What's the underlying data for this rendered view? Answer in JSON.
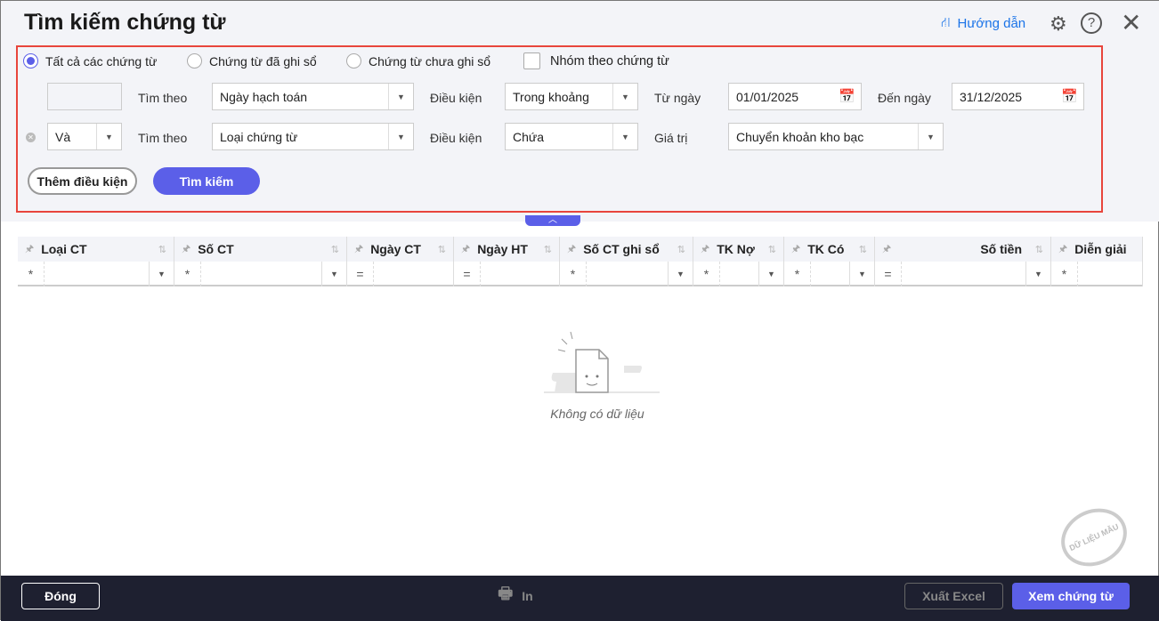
{
  "title": "Tìm kiếm chứng từ",
  "header": {
    "guide": "Hướng dẫn"
  },
  "filters": {
    "radios": [
      "Tất cả các chứng từ",
      "Chứng từ đã ghi sổ",
      "Chứng từ chưa ghi sổ"
    ],
    "selected_radio": 0,
    "group_checkbox": "Nhóm theo chứng từ",
    "row1": {
      "search_by_label": "Tìm theo",
      "search_by": "Ngày hạch toán",
      "cond_label": "Điều kiện",
      "cond": "Trong khoảng",
      "from_label": "Từ ngày",
      "from": "01/01/2025",
      "to_label": "Đến ngày",
      "to": "31/12/2025"
    },
    "row2": {
      "logic": "Và",
      "search_by_label": "Tìm theo",
      "search_by": "Loại chứng từ",
      "cond_label": "Điều kiện",
      "cond": "Chứa",
      "value_label": "Giá trị",
      "value": "Chuyển khoản kho bạc"
    },
    "add_condition": "Thêm điều kiện",
    "search": "Tìm kiếm"
  },
  "grid": {
    "columns": [
      "Loại CT",
      "Số CT",
      "Ngày CT",
      "Ngày HT",
      "Số CT ghi sổ",
      "TK Nợ",
      "TK Có",
      "Số tiền",
      "Diễn giải"
    ],
    "filter_ops": [
      "*",
      "*",
      "=",
      "=",
      "*",
      "*",
      "*",
      "=",
      "*"
    ],
    "empty": "Không có dữ liệu"
  },
  "watermark": "DỮ LIỆU MẪU",
  "footer": {
    "close": "Đóng",
    "print": "In",
    "export": "Xuất Excel",
    "view": "Xem chứng từ"
  },
  "colors": {
    "accent": "#5b5fe8",
    "highlight": "#e8453c",
    "footer": "#1e2030"
  }
}
